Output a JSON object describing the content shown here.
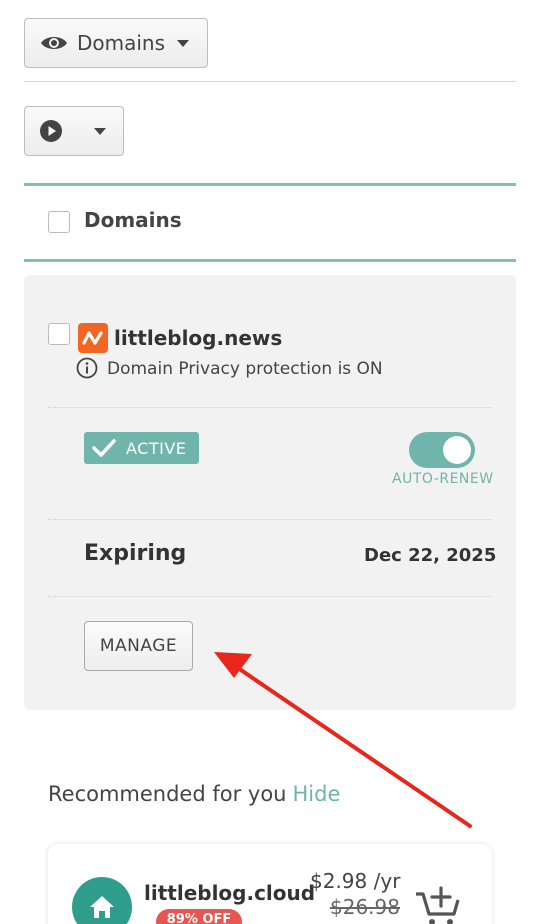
{
  "toolbar": {
    "filter_label": "Domains",
    "filter_icon": "eye-icon",
    "action_icon": "play-circle-icon"
  },
  "list_header": {
    "label": "Domains"
  },
  "domain_card": {
    "domain": "littleblog.news",
    "tld_logo": "news-tld-icon",
    "privacy_text": "Domain Privacy protection is ON",
    "status": "ACTIVE",
    "auto_renew_label": "AUTO-RENEW",
    "auto_renew_on": true,
    "expiring_label": "Expiring",
    "expiring_date": "Dec 22, 2025",
    "manage_label": "MANAGE"
  },
  "recommended": {
    "title": "Recommended for you",
    "hide_label": "Hide",
    "items": [
      {
        "domain": "littleblog.cloud",
        "discount": "89% OFF",
        "price": "$2.98 /yr",
        "old_price": "$26.98"
      }
    ]
  },
  "colors": {
    "accent": "#6fb5ab",
    "discount": "#e8574f",
    "tld_logo": "#f26522",
    "annotation_arrow": "#e8261c"
  }
}
